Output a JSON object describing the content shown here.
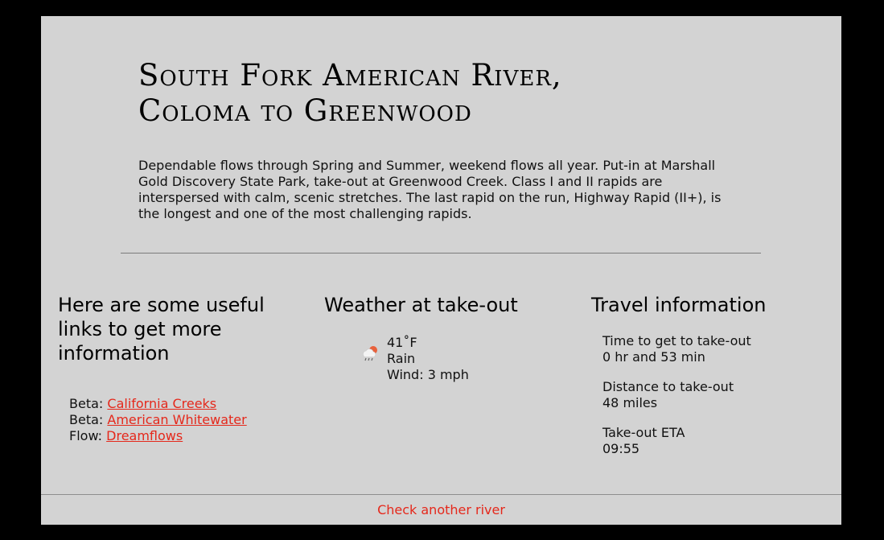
{
  "river": {
    "title_line1": "South Fork American River,",
    "title_line2": "Coloma to Greenwood",
    "description": "Dependable flows through Spring and Summer, weekend flows all year. Put-in at Marshall Gold Discovery State Park, take-out at Greenwood Creek. Class I and II rapids are interspersed with calm, scenic stretches. The last rapid on the run, Highway Rapid (II+), is the longest and one of the most challenging rapids."
  },
  "links": {
    "heading": "Here are some useful links to get more information",
    "items": [
      {
        "prefix": "Beta:",
        "label": "California Creeks"
      },
      {
        "prefix": "Beta:",
        "label": "American Whitewater"
      },
      {
        "prefix": "Flow:",
        "label": "Dreamflows"
      }
    ]
  },
  "weather": {
    "heading": "Weather at take-out",
    "icon": "rain-cloud-icon",
    "temperature": "41˚F",
    "condition": "Rain",
    "wind": "Wind: 3 mph"
  },
  "travel": {
    "heading": "Travel information",
    "items": [
      {
        "label": "Time to get to take-out",
        "value": "0 hr and 53 min"
      },
      {
        "label": "Distance to take-out",
        "value": "48 miles"
      },
      {
        "label": "Take-out ETA",
        "value": "09:55"
      }
    ]
  },
  "footer": {
    "link_label": "Check another river"
  },
  "colors": {
    "background": "#000000",
    "panel": "#d3d3d3",
    "link": "#e5281b"
  }
}
